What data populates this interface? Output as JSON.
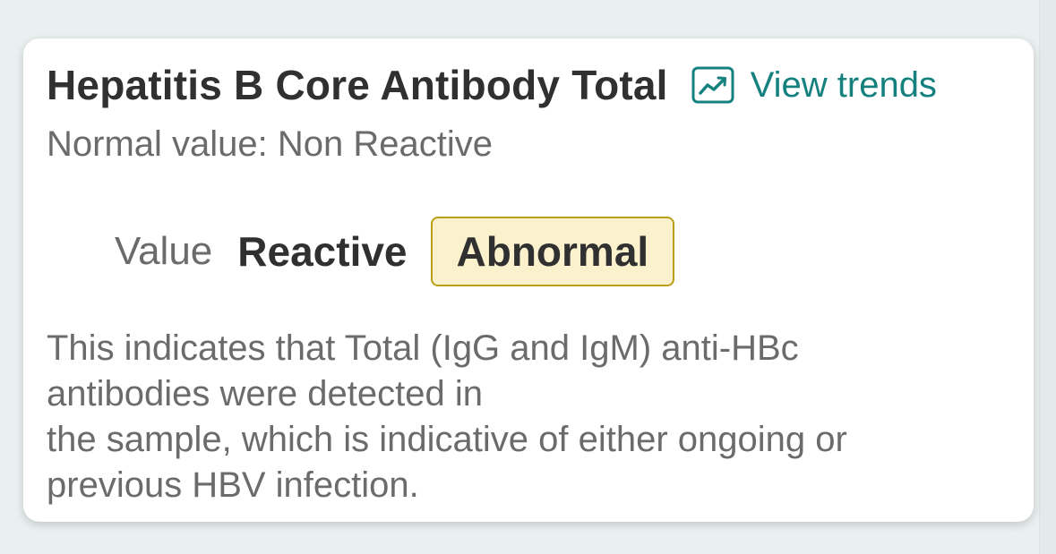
{
  "card": {
    "title": "Hepatitis B Core Antibody Total",
    "view_trends_label": "View trends",
    "trends_icon": "trend-chart-icon",
    "normal_value": "Normal value: Non Reactive",
    "value_label": "Value",
    "value": "Reactive",
    "status_badge": "Abnormal",
    "description_lines": [
      "This indicates that Total (IgG and IgM) anti-HBc",
      "antibodies were detected in",
      "the sample, which is indicative of either ongoing or",
      "previous HBV infection."
    ]
  },
  "colors": {
    "accent": "#15817f",
    "badge_background": "#fbf2cd",
    "badge_border": "#b99f16",
    "title_text": "#303030",
    "secondary_text": "#6b6b6b",
    "page_background": "#eaf0f0"
  }
}
